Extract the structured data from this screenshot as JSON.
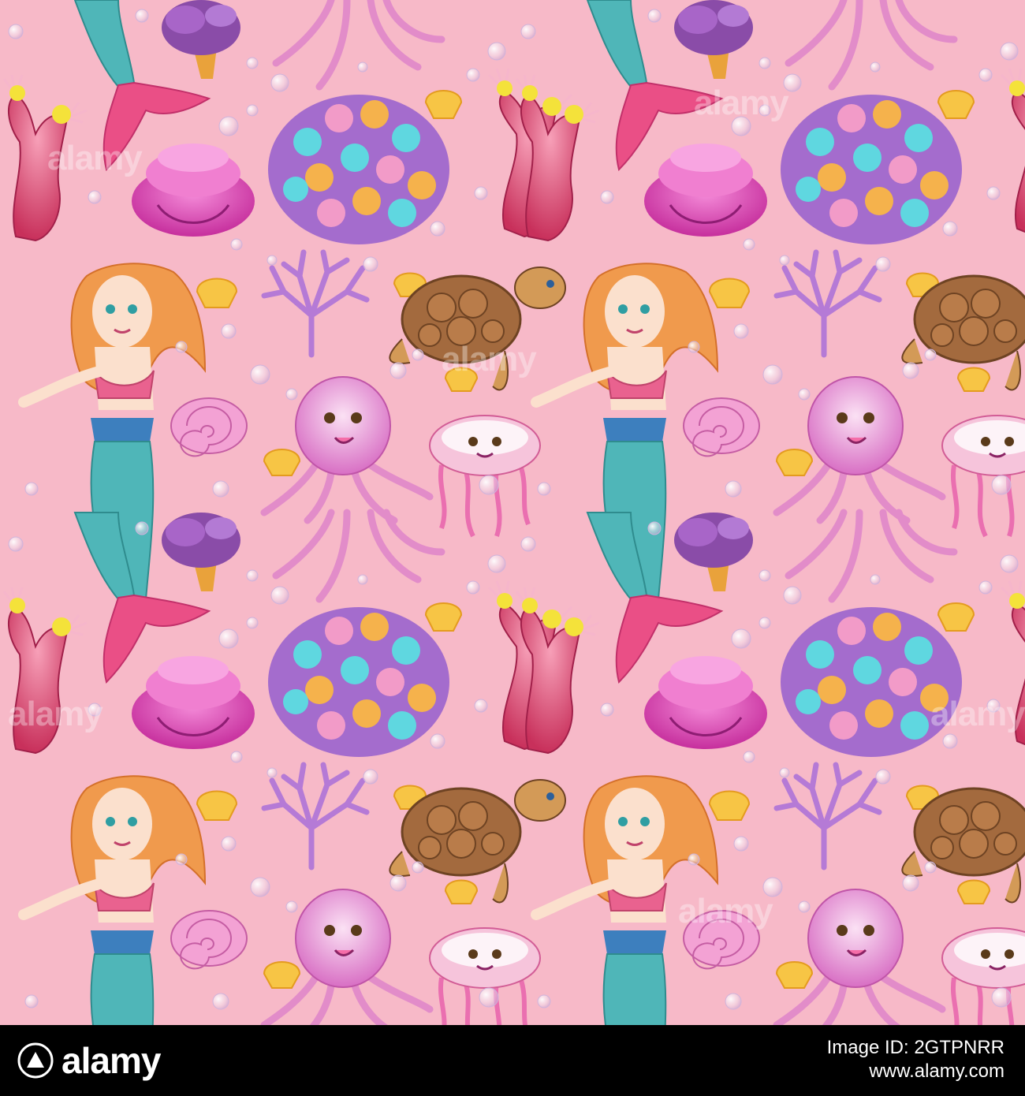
{
  "colors": {
    "background": "#f7b9c8",
    "footer_bg": "#000000",
    "footer_text": "#ffffff",
    "mermaid_tail": "#4fb6b8",
    "mermaid_hair": "#f09a4d",
    "turtle_shell": "#a36a3e",
    "jellyfish": "#e88fcf",
    "coral_purple": "#b57ad6",
    "shell_yellow": "#f7c545"
  },
  "watermark": {
    "text": "alamy"
  },
  "footer": {
    "brand": "alamy",
    "image_id_line": "Image ID: 2GTPNRR",
    "url": "www.alamy.com"
  }
}
